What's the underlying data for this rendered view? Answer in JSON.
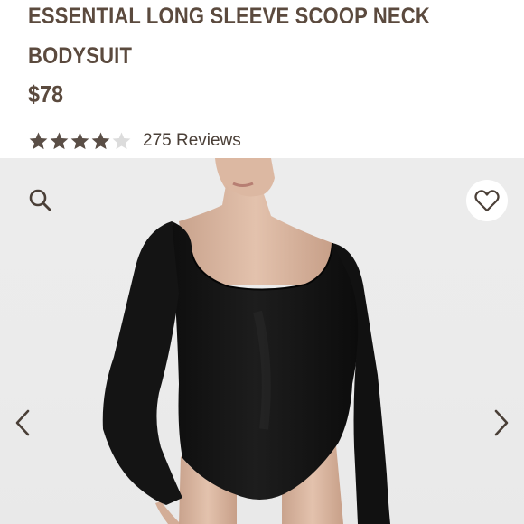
{
  "product": {
    "title": "ESSENTIAL LONG SLEEVE SCOOP NECK BODYSUIT",
    "price": "$78",
    "rating": 4,
    "rating_max": 5,
    "reviews_label": "275 Reviews"
  },
  "colors": {
    "text": "#5b4a3e",
    "star_filled": "#5a4e46",
    "star_empty": "#dcdcdc",
    "image_bg": "#ebebeb",
    "garment": "#151515"
  },
  "icons": {
    "search": "search-icon",
    "favorite": "heart-icon",
    "prev": "chevron-left-icon",
    "next": "chevron-right-icon"
  }
}
